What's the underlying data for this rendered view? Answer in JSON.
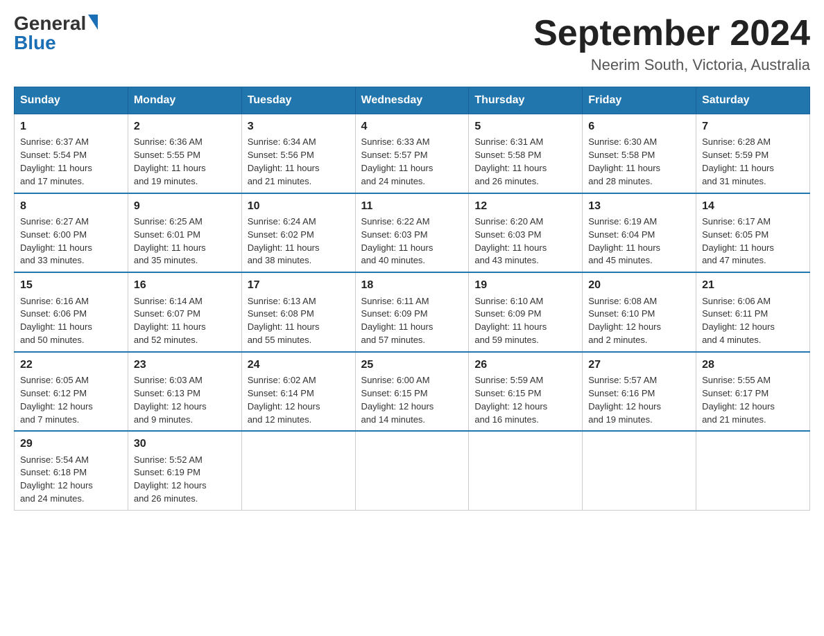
{
  "header": {
    "logo_general": "General",
    "logo_blue": "Blue",
    "title": "September 2024",
    "subtitle": "Neerim South, Victoria, Australia"
  },
  "weekdays": [
    "Sunday",
    "Monday",
    "Tuesday",
    "Wednesday",
    "Thursday",
    "Friday",
    "Saturday"
  ],
  "weeks": [
    [
      {
        "day": "1",
        "sunrise": "6:37 AM",
        "sunset": "5:54 PM",
        "daylight": "11 hours and 17 minutes."
      },
      {
        "day": "2",
        "sunrise": "6:36 AM",
        "sunset": "5:55 PM",
        "daylight": "11 hours and 19 minutes."
      },
      {
        "day": "3",
        "sunrise": "6:34 AM",
        "sunset": "5:56 PM",
        "daylight": "11 hours and 21 minutes."
      },
      {
        "day": "4",
        "sunrise": "6:33 AM",
        "sunset": "5:57 PM",
        "daylight": "11 hours and 24 minutes."
      },
      {
        "day": "5",
        "sunrise": "6:31 AM",
        "sunset": "5:58 PM",
        "daylight": "11 hours and 26 minutes."
      },
      {
        "day": "6",
        "sunrise": "6:30 AM",
        "sunset": "5:58 PM",
        "daylight": "11 hours and 28 minutes."
      },
      {
        "day": "7",
        "sunrise": "6:28 AM",
        "sunset": "5:59 PM",
        "daylight": "11 hours and 31 minutes."
      }
    ],
    [
      {
        "day": "8",
        "sunrise": "6:27 AM",
        "sunset": "6:00 PM",
        "daylight": "11 hours and 33 minutes."
      },
      {
        "day": "9",
        "sunrise": "6:25 AM",
        "sunset": "6:01 PM",
        "daylight": "11 hours and 35 minutes."
      },
      {
        "day": "10",
        "sunrise": "6:24 AM",
        "sunset": "6:02 PM",
        "daylight": "11 hours and 38 minutes."
      },
      {
        "day": "11",
        "sunrise": "6:22 AM",
        "sunset": "6:03 PM",
        "daylight": "11 hours and 40 minutes."
      },
      {
        "day": "12",
        "sunrise": "6:20 AM",
        "sunset": "6:03 PM",
        "daylight": "11 hours and 43 minutes."
      },
      {
        "day": "13",
        "sunrise": "6:19 AM",
        "sunset": "6:04 PM",
        "daylight": "11 hours and 45 minutes."
      },
      {
        "day": "14",
        "sunrise": "6:17 AM",
        "sunset": "6:05 PM",
        "daylight": "11 hours and 47 minutes."
      }
    ],
    [
      {
        "day": "15",
        "sunrise": "6:16 AM",
        "sunset": "6:06 PM",
        "daylight": "11 hours and 50 minutes."
      },
      {
        "day": "16",
        "sunrise": "6:14 AM",
        "sunset": "6:07 PM",
        "daylight": "11 hours and 52 minutes."
      },
      {
        "day": "17",
        "sunrise": "6:13 AM",
        "sunset": "6:08 PM",
        "daylight": "11 hours and 55 minutes."
      },
      {
        "day": "18",
        "sunrise": "6:11 AM",
        "sunset": "6:09 PM",
        "daylight": "11 hours and 57 minutes."
      },
      {
        "day": "19",
        "sunrise": "6:10 AM",
        "sunset": "6:09 PM",
        "daylight": "11 hours and 59 minutes."
      },
      {
        "day": "20",
        "sunrise": "6:08 AM",
        "sunset": "6:10 PM",
        "daylight": "12 hours and 2 minutes."
      },
      {
        "day": "21",
        "sunrise": "6:06 AM",
        "sunset": "6:11 PM",
        "daylight": "12 hours and 4 minutes."
      }
    ],
    [
      {
        "day": "22",
        "sunrise": "6:05 AM",
        "sunset": "6:12 PM",
        "daylight": "12 hours and 7 minutes."
      },
      {
        "day": "23",
        "sunrise": "6:03 AM",
        "sunset": "6:13 PM",
        "daylight": "12 hours and 9 minutes."
      },
      {
        "day": "24",
        "sunrise": "6:02 AM",
        "sunset": "6:14 PM",
        "daylight": "12 hours and 12 minutes."
      },
      {
        "day": "25",
        "sunrise": "6:00 AM",
        "sunset": "6:15 PM",
        "daylight": "12 hours and 14 minutes."
      },
      {
        "day": "26",
        "sunrise": "5:59 AM",
        "sunset": "6:15 PM",
        "daylight": "12 hours and 16 minutes."
      },
      {
        "day": "27",
        "sunrise": "5:57 AM",
        "sunset": "6:16 PM",
        "daylight": "12 hours and 19 minutes."
      },
      {
        "day": "28",
        "sunrise": "5:55 AM",
        "sunset": "6:17 PM",
        "daylight": "12 hours and 21 minutes."
      }
    ],
    [
      {
        "day": "29",
        "sunrise": "5:54 AM",
        "sunset": "6:18 PM",
        "daylight": "12 hours and 24 minutes."
      },
      {
        "day": "30",
        "sunrise": "5:52 AM",
        "sunset": "6:19 PM",
        "daylight": "12 hours and 26 minutes."
      },
      null,
      null,
      null,
      null,
      null
    ]
  ],
  "labels": {
    "sunrise": "Sunrise:",
    "sunset": "Sunset:",
    "daylight": "Daylight:"
  }
}
